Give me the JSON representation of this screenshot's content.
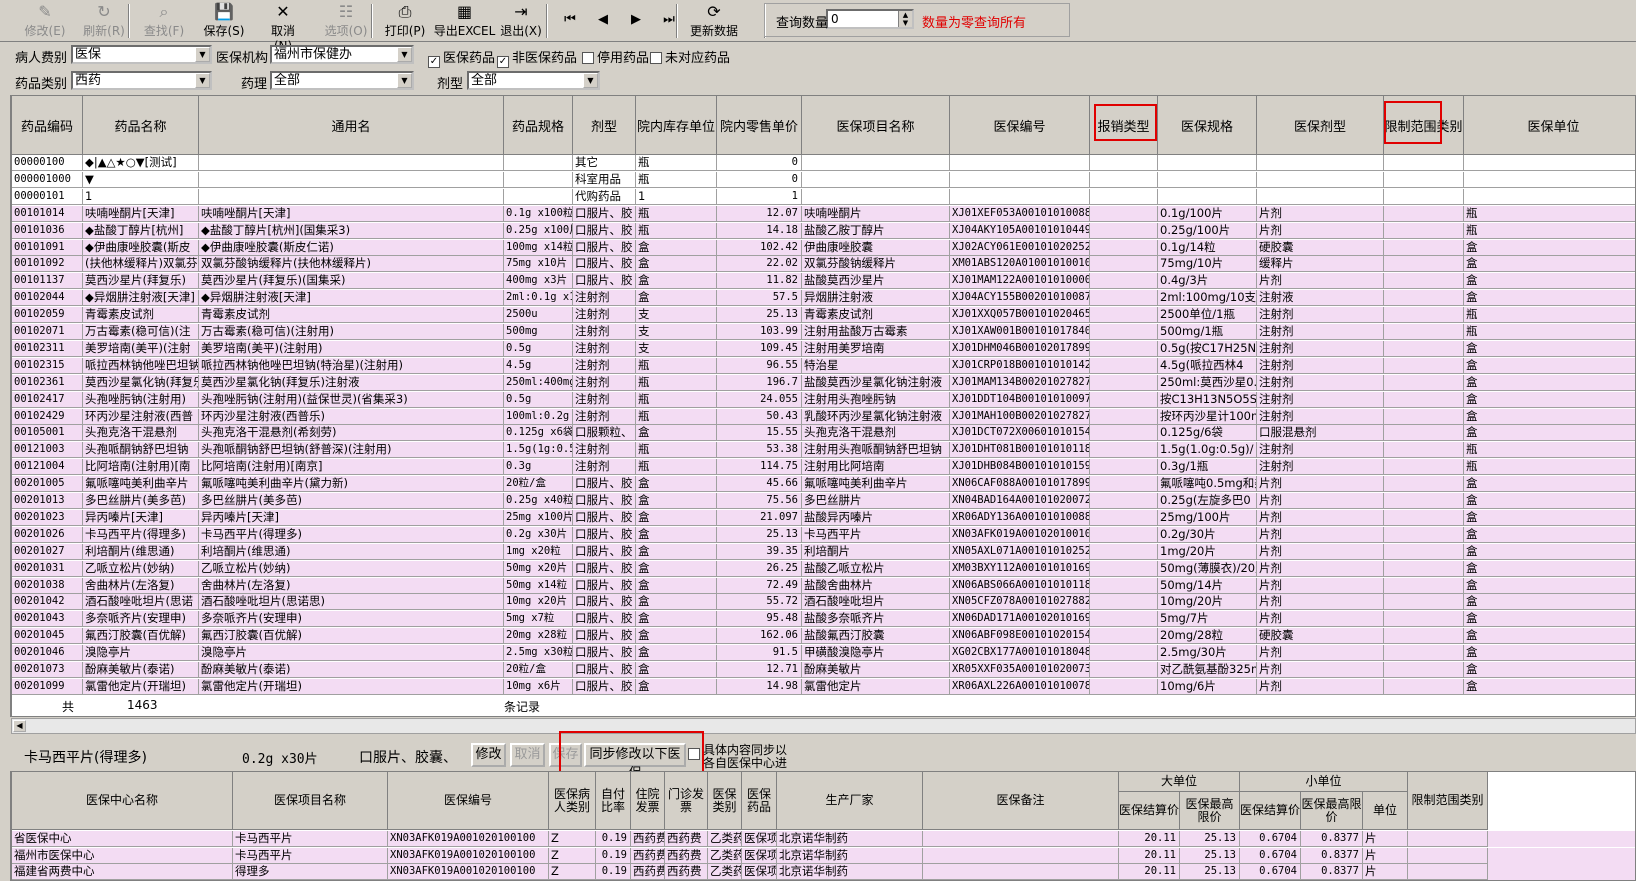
{
  "toolbar": {
    "buttons": [
      {
        "label": "修改(E)",
        "icon": "✎",
        "disabled": true
      },
      {
        "label": "刷新(R)",
        "icon": "↻",
        "disabled": true
      },
      {
        "label": "查找(F)",
        "icon": "⌕",
        "disabled": true
      },
      {
        "label": "保存(S)",
        "icon": "💾",
        "disabled": false
      },
      {
        "label": "取消(N)",
        "icon": "✕",
        "disabled": false
      },
      {
        "label": "选项(O)",
        "icon": "☷",
        "disabled": true
      },
      {
        "label": "打印(P)",
        "icon": "⎙",
        "disabled": false
      },
      {
        "label": "导出EXCEL",
        "icon": "▦",
        "disabled": false
      },
      {
        "label": "退出(X)",
        "icon": "⇥",
        "disabled": false
      },
      {
        "label": "⏮",
        "icon": "",
        "disabled": false
      },
      {
        "label": "◀",
        "icon": "",
        "disabled": false
      },
      {
        "label": "▶",
        "icon": "",
        "disabled": false
      },
      {
        "label": "⏭",
        "icon": "",
        "disabled": false
      },
      {
        "label": "更新数据",
        "icon": "⟳",
        "disabled": false
      }
    ],
    "query_count_label": "查询数量",
    "query_count_value": "0",
    "query_hint": "数量为零查询所有"
  },
  "filters": {
    "patient_type_label": "病人费别",
    "patient_type_value": "医保",
    "insurance_org_label": "医保机构",
    "insurance_org_value": "福州市保健办",
    "chk_insured": "医保药品",
    "chk_noninsured": "非医保药品",
    "chk_disabled": "停用药品",
    "chk_unmapped": "未对应药品",
    "drug_category_label": "药品类别",
    "drug_category_value": "西药",
    "pharmacology_label": "药理",
    "pharmacology_value": "全部",
    "dosage_label": "剂型",
    "dosage_value": "全部"
  },
  "grid": {
    "headers": [
      "药品编码",
      "药品名称",
      "通用名",
      "药品规格",
      "剂型",
      "院内库存单位",
      "院内零售单价",
      "医保项目名称",
      "医保编号",
      "报销类型",
      "医保规格",
      "医保剂型",
      "限制范围类别",
      "医保单位"
    ],
    "rows": [
      [
        "00000100",
        "◆|▲△★○▼[测试]",
        "",
        "",
        "其它",
        "瓶",
        "0",
        "",
        "",
        "",
        "",
        "",
        "",
        " "
      ],
      [
        "000001000",
        "▼",
        "",
        "",
        "科室用品",
        "瓶",
        "0",
        "",
        "",
        "",
        "",
        "",
        "",
        " "
      ],
      [
        "00000101",
        "1",
        "",
        "",
        "代购药品",
        "1",
        "1",
        "",
        "",
        "",
        "",
        "",
        "",
        " "
      ],
      [
        "00101014",
        "呋喃唑酮片[天津]",
        "呋喃唑酮片[天津]",
        "0.1g x100粒",
        "口服片、胶",
        "瓶",
        "12.07",
        "呋喃唑酮片",
        "XJ01XEF053A00101010088",
        "",
        "0.1g/100片",
        "片剂",
        "",
        "瓶"
      ],
      [
        "00101036",
        "◆盐酸丁醇片[杭州]",
        "◆盐酸丁醇片[杭州](国集采3)",
        "0.25g x100片",
        "口服片、胶",
        "瓶",
        "14.18",
        "盐酸乙胺丁醇片",
        "XJ04AKY105A00101010449",
        "",
        "0.25g/100片",
        "片剂",
        "",
        "瓶"
      ],
      [
        "00101091",
        "◆伊曲康唑胶囊(斯皮",
        "◆伊曲康唑胶囊(斯皮仁诺)",
        "100mg x14粒",
        "口服片、胶",
        "盒",
        "102.42",
        "伊曲康唑胶囊",
        "XJ02ACY061E00101020252",
        "",
        "0.1g/14粒",
        "硬胶囊",
        "",
        "盒"
      ],
      [
        "00101092",
        "(扶他林缓释片)双氯芬",
        "双氯芬酸钠缓释片(扶他林缓释片)",
        "75mg x10片",
        "口服片、胶",
        "盒",
        "22.02",
        "双氯芬酸钠缓释片",
        "XM01ABS120A01001010010",
        "",
        "75mg/10片",
        "缓释片",
        "",
        "盒"
      ],
      [
        "00101137",
        "莫西沙星片(拜复乐)",
        "莫西沙星片(拜复乐)(国集采)",
        "400mg x3片",
        "口服片、胶",
        "盒",
        "11.82",
        "盐酸莫西沙星片",
        "XJ01MAM122A00101010000",
        "",
        "0.4g/3片",
        "片剂",
        "",
        "盒"
      ],
      [
        "00102044",
        "◆异烟肼注射液[天津]",
        "◆异烟肼注射液[天津]",
        "2ml:0.1g x1",
        "注射剂",
        "盒",
        "57.5",
        "异烟肼注射液",
        "XJ04ACY155B00201010087",
        "",
        "2ml:100mg/10支",
        "注射液",
        "",
        "盒"
      ],
      [
        "00102059",
        "青霉素皮试剂",
        "青霉素皮试剂",
        "2500u",
        "注射剂",
        "支",
        "25.13",
        "青霉素皮试剂",
        "XJ01XXQ057B00101020465",
        "",
        "2500单位/1瓶",
        "注射剂",
        "",
        "瓶"
      ],
      [
        "00102071",
        "万古霉素(稳可信)(注",
        "万古霉素(稳可信)(注射用)",
        "500mg",
        "注射剂",
        "支",
        "103.99",
        "注射用盐酸万古霉素",
        "XJ01XAW001B00101017840",
        "",
        "500mg/1瓶",
        "注射剂",
        "",
        "瓶"
      ],
      [
        "00102311",
        "美罗培南(美平)(注射",
        "美罗培南(美平)(注射用)",
        "0.5g",
        "注射剂",
        "支",
        "109.45",
        "注射用美罗培南",
        "XJ01DHM046B00102017899",
        "",
        "0.5g(按C17H25N3",
        "注射剂",
        "",
        "盒"
      ],
      [
        "00102315",
        "哌拉西林钠他唑巴坦钠",
        "哌拉西林钠他唑巴坦钠(特治星)(注射用)",
        "4.5g",
        "注射剂",
        "瓶",
        "96.55",
        "特治星",
        "XJ01CRP018B00101010142",
        "",
        "4.5g(哌拉西林4",
        "注射剂",
        "",
        "盒"
      ],
      [
        "00102361",
        "莫西沙星氯化钠(拜复乐",
        "莫西沙星氯化钠(拜复乐)注射液",
        "250ml:400mg",
        "注射剂",
        "瓶",
        "196.7",
        "盐酸莫西沙星氯化钠注射液",
        "XJ01MAM134B00201027827",
        "",
        "250ml:莫西沙星0.",
        "注射剂",
        "",
        "盒"
      ],
      [
        "00102417",
        "头孢唑肟钠(注射用)",
        "头孢唑肟钠(注射用)(益保世灵)(省集采3)",
        "0.5g",
        "注射剂",
        "瓶",
        "24.055",
        "注射用头孢唑肟钠",
        "XJ01DDT104B00101010097",
        "",
        "按C13H13N5O5S2计",
        "注射剂",
        "",
        "盒"
      ],
      [
        "00102429",
        "环丙沙星注射液(西普",
        "环丙沙星注射液(西普乐)",
        "100ml:0.2g",
        "注射剂",
        "瓶",
        "50.43",
        "乳酸环丙沙星氯化钠注射液",
        "XJ01MAH100B00201027827",
        "",
        "按环丙沙星计100m",
        "注射剂",
        "",
        "盒"
      ],
      [
        "00105001",
        "头孢克洛干混悬剂",
        "头孢克洛干混悬剂(希刻劳)",
        "0.125g x6袋",
        "口服颗粒、",
        "盒",
        "15.55",
        "头孢克洛干混悬剂",
        "XJ01DCT072X00601010154",
        "",
        "0.125g/6袋",
        "口服混悬剂",
        "",
        "盒"
      ],
      [
        "00121003",
        "头孢哌酮钠舒巴坦钠",
        "头孢哌酮钠舒巴坦钠(舒普深)(注射用)",
        "1.5g(1g:0.5",
        "注射剂",
        "瓶",
        "53.38",
        "注射用头孢哌酮钠舒巴坦钠",
        "XJ01DHT081B00101010118",
        "",
        "1.5g(1.0g:0.5g)/",
        "注射剂",
        "",
        "瓶"
      ],
      [
        "00121004",
        "比阿培南(注射用)[南",
        "比阿培南(注射用)[南京]",
        "0.3g",
        "注射剂",
        "瓶",
        "114.75",
        "注射用比阿培南",
        "XJ01DHB084B00101010159",
        "",
        "0.3g/1瓶",
        "注射剂",
        "",
        "瓶"
      ],
      [
        "00201005",
        "氟哌噻吨美利曲辛片",
        "氟哌噻吨美利曲辛片(黛力新)",
        "20粒/盒",
        "口服片、胶",
        "盒",
        "45.66",
        "氟哌噻吨美利曲辛片",
        "XN06CAF088A00101017899",
        "",
        "氟哌噻吨0.5mg和美",
        "片剂",
        "",
        "盒"
      ],
      [
        "00201013",
        "多巴丝肼片(美多芭)",
        "多巴丝肼片(美多芭)",
        "0.25g x40粒",
        "口服片、胶",
        "盒",
        "75.56",
        "多巴丝肼片",
        "XN04BAD164A00101020072",
        "",
        "0.25g(左旋多巴0",
        "片剂",
        "",
        "盒"
      ],
      [
        "00201023",
        "异丙嗪片[天津]",
        "异丙嗪片[天津]",
        "25mg x100片",
        "口服片、胶",
        "盒",
        "21.097",
        "盐酸异丙嗪片",
        "XR06ADY136A00101010088",
        "",
        "25mg/100片",
        "片剂",
        "",
        "盒"
      ],
      [
        "00201026",
        "卡马西平片(得理多)",
        "卡马西平片(得理多)",
        "0.2g x30片",
        "口服片、胶",
        "盒",
        "25.13",
        "卡马西平片",
        "XN03AFK019A00102010010",
        "",
        "0.2g/30片",
        "片剂",
        "",
        "盒"
      ],
      [
        "00201027",
        "利培酮片(维思通)",
        "利培酮片(维思通)",
        "1mg x20粒",
        "口服片、胶",
        "盒",
        "39.35",
        "利培酮片",
        "XN05AXL071A00101010252",
        "",
        "1mg/20片",
        "片剂",
        "",
        "盒"
      ],
      [
        "00201031",
        "乙哌立松片(妙纳)",
        "乙哌立松片(妙纳)",
        "50mg x20片",
        "口服片、胶",
        "盒",
        "26.25",
        "盐酸乙哌立松片",
        "XM03BXY112A00101010169",
        "",
        "50mg(薄膜衣)/20片",
        "片剂",
        "",
        "盒"
      ],
      [
        "00201038",
        "舍曲林片(左洛复)",
        "舍曲林片(左洛复)",
        "50mg x14粒",
        "口服片、胶",
        "盒",
        "72.49",
        "盐酸舍曲林片",
        "XN06ABS066A00101010118",
        "",
        "50mg/14片",
        "片剂",
        "",
        "盒"
      ],
      [
        "00201042",
        "酒石酸唑吡坦片(思诺",
        "酒石酸唑吡坦片(思诺思)",
        "10mg x20片",
        "口服片、胶",
        "盒",
        "55.72",
        "酒石酸唑吡坦片",
        "XN05CFZ078A00101027882",
        "",
        "10mg/20片",
        "片剂",
        "",
        "盒"
      ],
      [
        "00201043",
        "多奈哌齐片(安理申)",
        "多奈哌齐片(安理申)",
        "5mg x7粒",
        "口服片、胶",
        "盒",
        "95.48",
        "盐酸多奈哌齐片",
        "XN06DAD171A00102010169",
        "",
        "5mg/7片",
        "片剂",
        "",
        "盒"
      ],
      [
        "00201045",
        "氟西汀胶囊(百优解)",
        "氟西汀胶囊(百优解)",
        "20mg x28粒",
        "口服片、胶",
        "盒",
        "162.06",
        "盐酸氟西汀胶囊",
        "XN06ABF098E00101020154",
        "",
        "20mg/28粒",
        "硬胶囊",
        "",
        "盒"
      ],
      [
        "00201046",
        "溴隐亭片",
        "溴隐亭片",
        "2.5mg x30粒",
        "口服片、胶",
        "盒",
        "91.5",
        "甲磺酸溴隐亭片",
        "XG02CBX177A00101018048",
        "",
        "2.5mg/30片",
        "片剂",
        "",
        "盒"
      ],
      [
        "00201073",
        "酚麻美敏片(泰诺)",
        "酚麻美敏片(泰诺)",
        "20粒/盒",
        "口服片、胶",
        "盒",
        "12.71",
        "酚麻美敏片",
        "XR05XXF035A00101020073",
        "",
        "对乙酰氨基酚325m",
        "片剂",
        "",
        "盒"
      ],
      [
        "00201099",
        "氯雷他定片(开瑞坦)",
        "氯雷他定片(开瑞坦)",
        "10mg x6片",
        "口服片、胶",
        "盒",
        "14.98",
        "氯雷他定片",
        "XR06AXL226A00101010078",
        "",
        "10mg/6片",
        "片剂",
        "",
        "盒"
      ]
    ],
    "footer_total_label": "共",
    "footer_total_value": "1463",
    "footer_records_label": "条记录"
  },
  "detail": {
    "drug_name": "卡马西平片(得理多)",
    "spec": "0.2g x30片",
    "dosage": "口服片、胶囊、",
    "btn_edit": "修改",
    "btn_cancel": "取消",
    "btn_save": "保存",
    "btn_sync": "同步修改以下医保",
    "chk_sync_line1": "具体内容同步以",
    "chk_sync_line2": "各自医保中心进"
  },
  "bottom": {
    "headers": [
      "医保中心名称",
      "医保项目名称",
      "医保编号",
      "医保病人类别",
      "自付比率",
      "住院发票",
      "门诊发票",
      "医保类别",
      "医保药品",
      "生产厂家",
      "医保备注",
      "大单位",
      "医保结算价",
      "医保最高限价",
      "小单位",
      "医保结算价",
      "医保最高限价",
      "单位",
      "限制范围类别"
    ],
    "rows": [
      [
        "省医保中心",
        "卡马西平片",
        "XN03AFK019A001020100100",
        "Z",
        "0.19",
        "西药费",
        "西药费",
        "乙类药",
        "医保项",
        "北京诺华制药",
        "",
        "20.11",
        "25.13",
        "0.6704",
        "0.8377",
        "片",
        ""
      ],
      [
        "福州市医保中心",
        "卡马西平片",
        "XN03AFK019A001020100100",
        "Z",
        "0.19",
        "西药费",
        "西药费",
        "乙类药",
        "医保项",
        "北京诺华制药",
        "",
        "20.11",
        "25.13",
        "0.6704",
        "0.8377",
        "片",
        ""
      ],
      [
        "福建省两费中心",
        "得理多",
        "XN03AFK019A001020100100",
        "Z",
        "0.19",
        "西药费",
        "西药费",
        "乙类药",
        "医保项",
        "北京诺华制药",
        "",
        "20.11",
        "25.13",
        "0.6704",
        "0.8377",
        "片",
        ""
      ]
    ]
  }
}
